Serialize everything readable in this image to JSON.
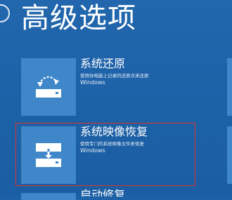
{
  "page": {
    "title": "高级选项"
  },
  "options": [
    {
      "title": "系统还原",
      "description": "使用你电脑上记录的还原点来还原",
      "description_line2": "Windows",
      "icon": "system-restore-icon"
    },
    {
      "title": "系统映像恢复",
      "description": "使用专门的系统映像文件来恢复",
      "description_line2": "Windows",
      "icon": "system-image-recovery-icon"
    },
    {
      "title": "启动修复",
      "icon": "startup-repair-icon"
    }
  ],
  "colors": {
    "background": "#1d62a8",
    "tile": "#3f87c9",
    "highlight": "#d9342b"
  }
}
